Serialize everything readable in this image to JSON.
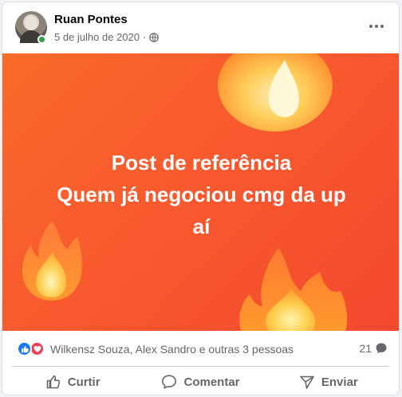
{
  "post": {
    "author": "Ruan Pontes",
    "date": "5 de julho de 2020",
    "separator": "·",
    "privacy_icon": "globe-icon",
    "text_line_1": "Post de referência",
    "text_line_2": "Quem já negociou cmg da up",
    "text_line_3": "aí",
    "background_colors": [
      "#fa6a2a",
      "#f4482f"
    ]
  },
  "reactions": {
    "icons": [
      "like-icon",
      "love-icon"
    ],
    "summary": "Wilkensz Souza, Alex Sandro e outras 3 pessoas",
    "comments_count": "21"
  },
  "actions": {
    "like_label": "Curtir",
    "comment_label": "Comentar",
    "share_label": "Enviar"
  },
  "colors": {
    "like_blue": "#1877f2",
    "love_red": "#f33e58",
    "online_green": "#31a24c",
    "secondary_text": "#65676b"
  }
}
